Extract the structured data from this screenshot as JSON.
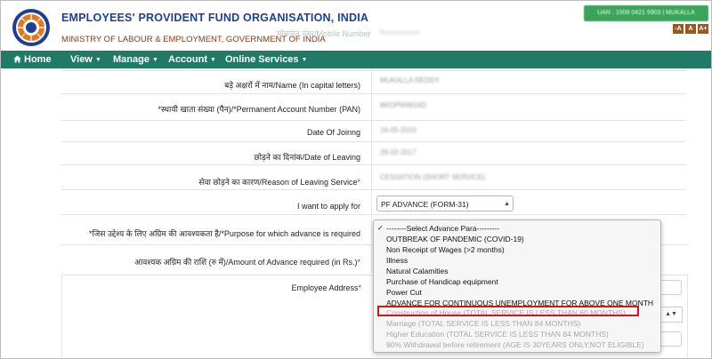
{
  "header": {
    "org_name": "EMPLOYEES' PROVIDENT FUND ORGANISATION, INDIA",
    "ministry": "MINISTRY OF LABOUR & EMPLOYMENT, GOVERNMENT OF INDIA",
    "ghost_label": "मोबाइल नंबर/Mobile Number",
    "ghost_value": "9xxxxxxxxx",
    "login_badge": "UAN : 1009 0421 5903 | MUKALLA",
    "font_buttons": [
      "-A",
      "A",
      "A+"
    ]
  },
  "nav": {
    "items": [
      {
        "label": "Home",
        "icon": "home-icon",
        "caret": false
      },
      {
        "label": "View",
        "caret": true
      },
      {
        "label": "Manage",
        "caret": true
      },
      {
        "label": "Account",
        "caret": true
      },
      {
        "label": "Online Services",
        "caret": true
      }
    ]
  },
  "form": {
    "rows": [
      {
        "label": "बड़े अक्षरों में नाम/Name (In capital letters)",
        "value": "MUKALLA REDDY",
        "required": false
      },
      {
        "label": "*स्थायी खाता संख्या (पैन)/*Permanent Account Number (PAN)",
        "value": "BKDPM4816D",
        "required": false
      },
      {
        "label": "Date Of Joinng",
        "value": "16-05-2016",
        "required": false
      },
      {
        "label": "छोड़ने का दिनांक/Date of Leaving",
        "value": "28-02-2017",
        "required": false
      },
      {
        "label": "सेवा छोड़ने का कारण/Reason of Leaving Service",
        "value": "CESSATION (SHORT SERVICE)",
        "required": true
      },
      {
        "label": "I want to apply for",
        "value": "",
        "required": false
      },
      {
        "label": "*जिस उद्देश्य के लिए अग्रिम की आवश्यकता है/*Purpose for which advance is required",
        "value": "",
        "required": false
      },
      {
        "label": "आवश्यक अग्रिम की राशि (रु में)/Amount of Advance required (in Rs.)",
        "value": "",
        "required": true
      }
    ],
    "apply_for_selected": "PF ADVANCE (FORM-31)",
    "address_label": "Employee Address",
    "address_required": true
  },
  "purpose_dropdown": {
    "options": [
      {
        "label": "--------Select Advance Para---------",
        "checked": true,
        "disabled": false
      },
      {
        "label": "OUTBREAK OF PANDEMIC (COVID-19)",
        "disabled": false
      },
      {
        "label": "Non Receipt of Wages (>2 months)",
        "disabled": false
      },
      {
        "label": "Illness",
        "disabled": false
      },
      {
        "label": "Natural Calamities",
        "disabled": false
      },
      {
        "label": "Purchase of Handicap equipment",
        "disabled": false
      },
      {
        "label": "Power Cut",
        "disabled": false
      },
      {
        "label": "ADVANCE FOR CONTINUOUS UNEMPLOYMENT FOR ABOVE ONE MONTH",
        "disabled": false
      },
      {
        "label": "Construction of House (TOTAL SERVICE IS LESS THAN 60 MONTHS)",
        "disabled": true,
        "highlighted": true
      },
      {
        "label": "Marriage (TOTAL SERVICE IS LESS THAN 84 MONTHS)",
        "disabled": true
      },
      {
        "label": "Higher Education (TOTAL SERVICE IS LESS THAN 84 MONTHS)",
        "disabled": true
      },
      {
        "label": "90% Withdrawal before retirement (AGE IS 30YEARS ONLY,NOT ELIGIBLE)",
        "disabled": true
      }
    ],
    "check_glyph": "✓"
  },
  "colors": {
    "nav_bg": "#1f7a66",
    "title_blue": "#1d3f95",
    "ministry_brown": "#8a3a12",
    "highlight_red": "#d01818",
    "required_red": "#d22"
  }
}
